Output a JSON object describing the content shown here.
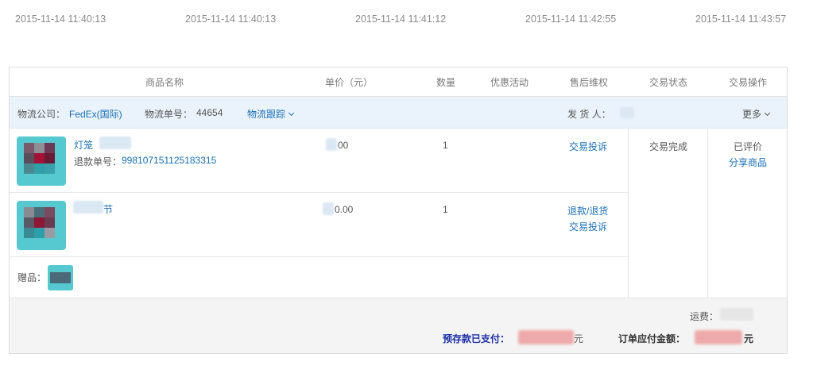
{
  "timeline": {
    "stamps": [
      "2015-11-14 11:40:13",
      "2015-11-14 11:40:13",
      "2015-11-14 11:41:12",
      "2015-11-14 11:42:55",
      "2015-11-14 11:43:57"
    ]
  },
  "table_header": {
    "product": "商品名称",
    "price": "单价（元）",
    "quantity": "数量",
    "promotion": "优惠活动",
    "after_sale": "售后维权",
    "status": "交易状态",
    "actions": "交易操作"
  },
  "logistics": {
    "company_label": "物流公司：",
    "company_value": "FedEx(国际)",
    "tracking_label": "物流单号：",
    "tracking_value": "44654",
    "track_link": "物流跟踪",
    "sender_label": "发 货 人：",
    "more": "更多"
  },
  "items": [
    {
      "name": "灯笼",
      "refund_label": "退款单号：",
      "refund_number": "998107151125183315",
      "price": "00",
      "quantity": "1",
      "actions": [
        "交易投诉"
      ]
    },
    {
      "name": "节",
      "price": "0.00",
      "quantity": "1",
      "actions": [
        "退款/退货",
        "交易投诉"
      ]
    }
  ],
  "gift": {
    "label": "赠品："
  },
  "order_status": {
    "status": "交易完成",
    "review_status": "已评价",
    "share_link": "分享商品"
  },
  "footer": {
    "shipping_label": "运费：",
    "deposit_label": "预存款已支付：",
    "deposit_unit": "元",
    "total_label": "订单应付金额：",
    "total_unit": "元"
  },
  "colors": {
    "link": "#1a6fb3",
    "deposit_label": "#1c2fa8",
    "logistics_bg": "#eaf3fb",
    "footer_bg": "#f4f4f4"
  }
}
